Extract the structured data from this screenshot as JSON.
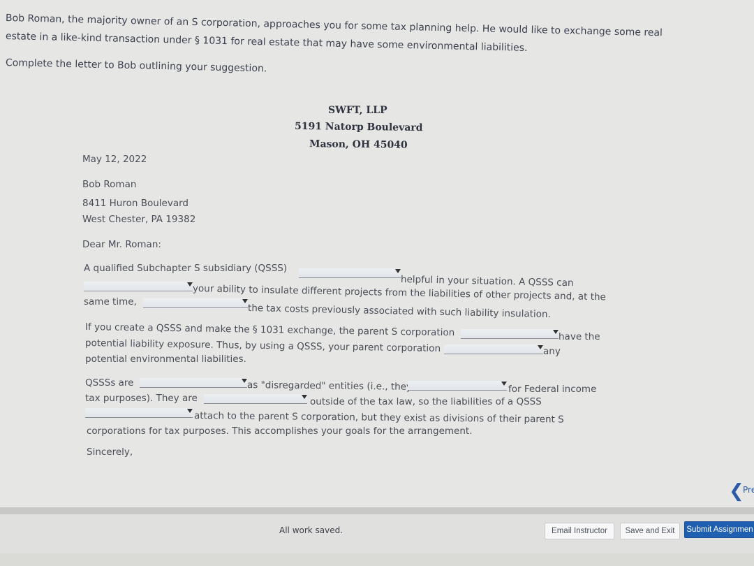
{
  "prompt": {
    "line1": "Bob Roman, the majority owner of an S corporation, approaches you for some tax planning help. He would like to exchange some real",
    "line2": "estate in a like-kind transaction under § 1031 for real estate that may have some environmental liabilities.",
    "instruction": "Complete the letter to Bob outlining your suggestion."
  },
  "letterhead": {
    "firm": "SWFT, LLP",
    "street": "5191 Natorp Boulevard",
    "city": "Mason, OH 45040"
  },
  "letter": {
    "date": "May 12, 2022",
    "recipient_name": "Bob Roman",
    "recipient_street": "8411 Huron Boulevard",
    "recipient_city": "West Chester, PA 19382",
    "salutation": "Dear Mr. Roman:",
    "p1_a": "A qualified Subchapter S subsidiary (QSSS)",
    "p1_b": "helpful in your situation. A QSSS can",
    "p1_c": "your ability to insulate different projects from the liabilities of other projects and, at the",
    "p1_d": "same time,",
    "p1_e": "the tax costs previously associated with such liability insulation.",
    "p2_a": "If you create a QSSS and make the § 1031 exchange, the parent S corporation",
    "p2_b": "have the",
    "p2_c": "potential liability exposure. Thus, by using a QSSS, your parent corporation",
    "p2_d": "any",
    "p2_e": "potential environmental liabilities.",
    "p3_a": "QSSSs are",
    "p3_b": "as \"disregarded\" entities (i.e., they",
    "p3_c": "for Federal income",
    "p3_d": "tax purposes). They are",
    "p3_e": "outside of the tax law, so the liabilities of a QSSS",
    "p3_f": "attach to the parent S corporation, but they exist as divisions of their parent S",
    "p3_g": "corporations for tax purposes. This accomplishes your goals for the arrangement.",
    "closing": "Sincerely,"
  },
  "footer": {
    "status": "All work saved.",
    "email_label": "Email Instructor",
    "save_label": "Save and Exit",
    "submit_label": "Submit Assignmen",
    "prev_label": "Pre"
  }
}
